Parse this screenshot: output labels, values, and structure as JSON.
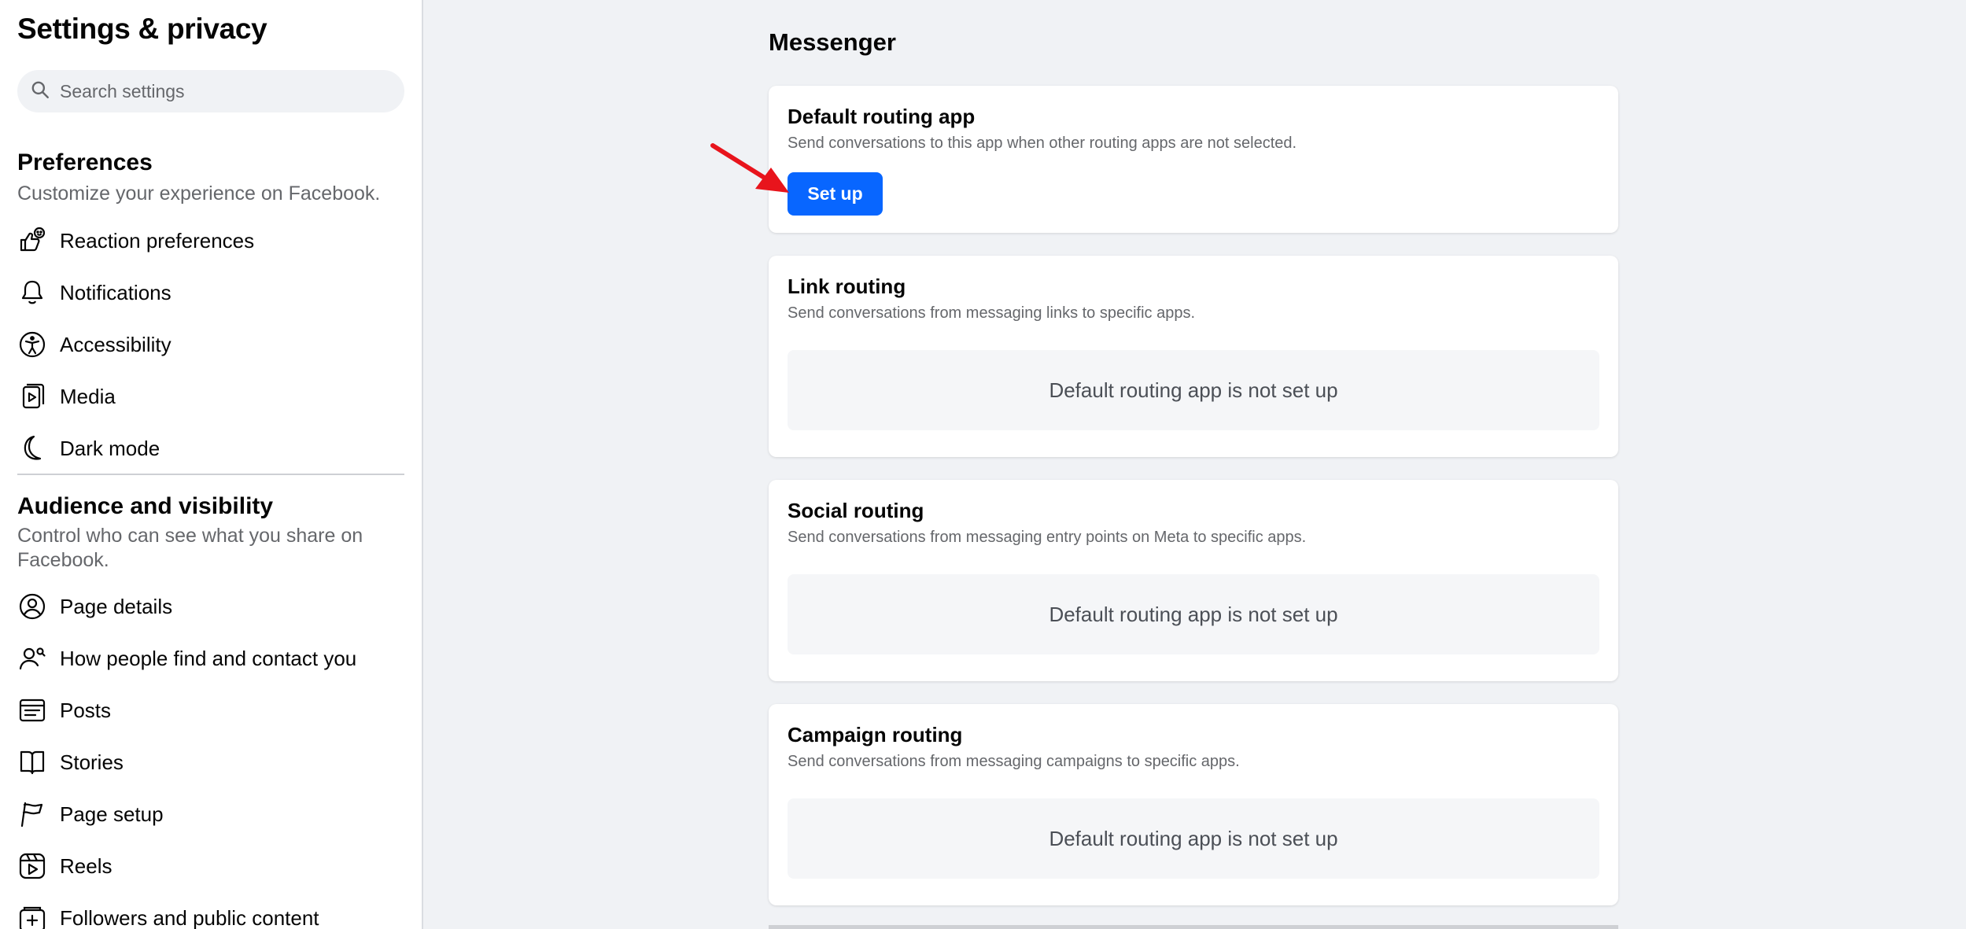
{
  "sidebar": {
    "title": "Settings & privacy",
    "search_placeholder": "Search settings",
    "preferences": {
      "title": "Preferences",
      "subtitle": "Customize your experience on Facebook.",
      "items": [
        {
          "label": "Reaction preferences",
          "icon": "reaction-icon"
        },
        {
          "label": "Notifications",
          "icon": "bell-icon"
        },
        {
          "label": "Accessibility",
          "icon": "accessibility-icon"
        },
        {
          "label": "Media",
          "icon": "media-icon"
        },
        {
          "label": "Dark mode",
          "icon": "moon-icon"
        }
      ]
    },
    "audience": {
      "title": "Audience and visibility",
      "subtitle": "Control who can see what you share on Facebook.",
      "items": [
        {
          "label": "Page details",
          "icon": "user-circle-icon"
        },
        {
          "label": "How people find and contact you",
          "icon": "user-search-icon"
        },
        {
          "label": "Posts",
          "icon": "posts-icon"
        },
        {
          "label": "Stories",
          "icon": "book-icon"
        },
        {
          "label": "Page setup",
          "icon": "flag-icon"
        },
        {
          "label": "Reels",
          "icon": "reels-icon"
        },
        {
          "label": "Followers and public content",
          "icon": "add-follower-icon"
        }
      ]
    }
  },
  "main": {
    "title": "Messenger",
    "cards": [
      {
        "title": "Default routing app",
        "description": "Send conversations to this app when other routing apps are not selected.",
        "button": "Set up"
      },
      {
        "title": "Link routing",
        "description": "Send conversations from messaging links to specific apps.",
        "status": "Default routing app is not set up"
      },
      {
        "title": "Social routing",
        "description": "Send conversations from messaging entry points on Meta to specific apps.",
        "status": "Default routing app is not set up"
      },
      {
        "title": "Campaign routing",
        "description": "Send conversations from messaging campaigns to specific apps.",
        "status": "Default routing app is not set up"
      }
    ]
  },
  "colors": {
    "accent": "#0866ff",
    "annotation_arrow": "#e8141c",
    "page_background": "#f0f2f5"
  }
}
